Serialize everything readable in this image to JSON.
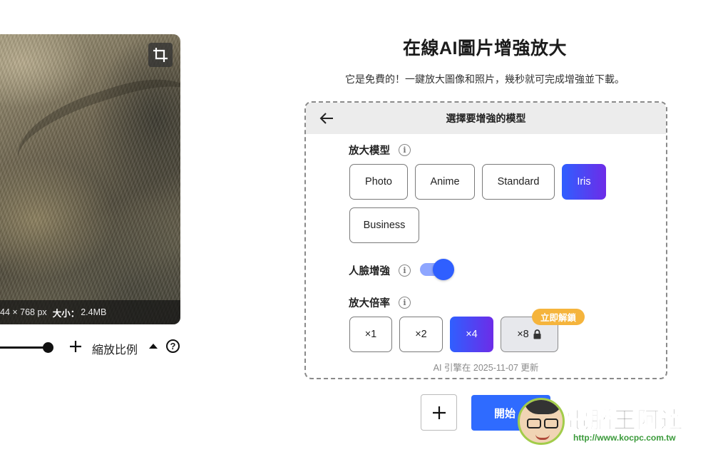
{
  "preview": {
    "dimensions": "44 × 768 px",
    "size_label": "大小：",
    "size_value": "2.4MB"
  },
  "zoom": {
    "label": "縮放比例",
    "help": "?",
    "slider_position_fraction": 1.0
  },
  "header": {
    "title": "在線AI圖片增強放大",
    "subtitle": "它是免費的！一鍵放大圖像和照片，幾秒就可完成增強並下載。"
  },
  "card": {
    "heading": "選擇要增強的模型",
    "model_section": {
      "label": "放大模型",
      "info": "i",
      "options": [
        "Photo",
        "Anime",
        "Standard",
        "Iris",
        "Business"
      ],
      "selected": "Iris"
    },
    "face_section": {
      "label": "人臉增強",
      "info": "i",
      "enabled": true
    },
    "scale_section": {
      "label": "放大倍率",
      "info": "i",
      "options": [
        "×1",
        "×2",
        "×4",
        "×8"
      ],
      "selected": "×4",
      "locked": "×8",
      "unlock_label": "立即解鎖"
    },
    "updated_text": "AI 引擎在 2025-11-07 更新"
  },
  "actions": {
    "start_label": "開始"
  },
  "watermark": {
    "title": "電腦王阿達",
    "url": "http://www.kocpc.com.tw"
  },
  "colors": {
    "accent_start": "#2f5fff",
    "accent_end": "#6d2ce8",
    "start_button": "#2f6bff",
    "unlock_badge": "#f5b43c"
  }
}
